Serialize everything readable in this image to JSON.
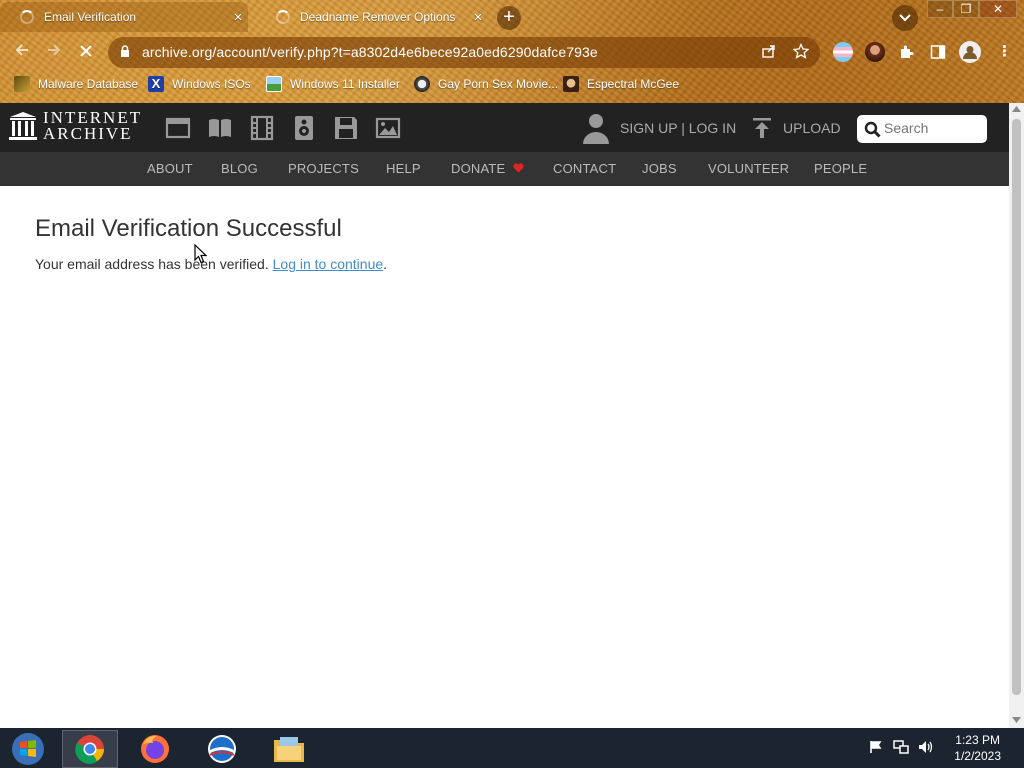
{
  "browser": {
    "tabs": [
      {
        "title": "Email Verification",
        "close": "×"
      },
      {
        "title": "Deadname Remover Options",
        "close": "×"
      }
    ],
    "new_tab": "+",
    "tab_search": "⌄",
    "window_controls": {
      "minimize": "–",
      "restore": "❐",
      "close": "✕"
    },
    "url": "archive.org/account/verify.php?t=a8302d4e6bece92a0ed6290dafce793e",
    "bookmarks": [
      {
        "label": "Malware Database",
        "icon": "malware-db-icon"
      },
      {
        "label": "Windows ISOs",
        "icon": "x-icon"
      },
      {
        "label": "Windows 11 Installer",
        "icon": "image-icon"
      },
      {
        "label": "Gay Porn Sex Movie...",
        "icon": "site-icon"
      },
      {
        "label": "Espectral McGee",
        "icon": "face-icon"
      }
    ]
  },
  "ia": {
    "logo_line1": "INTERNET",
    "logo_line2": "ARCHIVE",
    "signup_login": "SIGN UP | LOG IN",
    "upload": "UPLOAD",
    "search_placeholder": "Search",
    "nav": [
      "ABOUT",
      "BLOG",
      "PROJECTS",
      "HELP",
      "DONATE",
      "CONTACT",
      "JOBS",
      "VOLUNTEER",
      "PEOPLE"
    ],
    "accent": "#e02222"
  },
  "content": {
    "heading": "Email Verification Successful",
    "message_prefix": "Your email address has been verified.",
    "link_text": "Log in to continue",
    "message_suffix": "."
  },
  "taskbar": {
    "time": "1:23 PM",
    "date": "1/2/2023"
  }
}
